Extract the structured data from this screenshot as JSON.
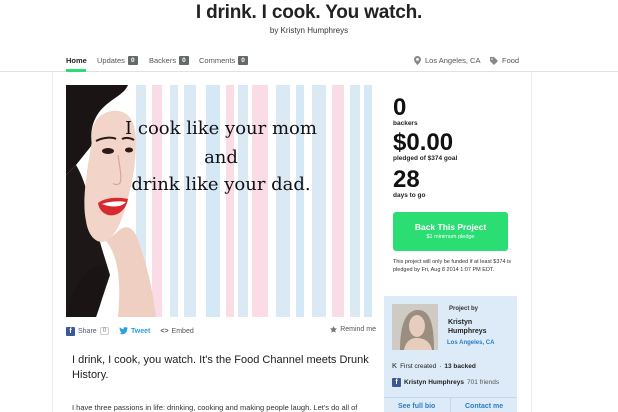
{
  "header": {
    "title": "I drink. I cook. You watch.",
    "byline": "by Kristyn Humphreys"
  },
  "nav": {
    "tabs": [
      {
        "label": "Home",
        "count": null
      },
      {
        "label": "Updates",
        "count": "0"
      },
      {
        "label": "Backers",
        "count": "0"
      },
      {
        "label": "Comments",
        "count": "0"
      }
    ],
    "location": "Los Angeles, CA",
    "category": "Food"
  },
  "video": {
    "line1": "I cook like your mom",
    "line2": "and",
    "line3": "drink like your dad."
  },
  "share": {
    "facebook": "Share",
    "facebook_count": "0",
    "tweet": "Tweet",
    "embed": "Embed",
    "remind": "Remind me"
  },
  "stats": {
    "backers_value": "0",
    "backers_label": "backers",
    "pledged_value": "$0.00",
    "pledged_label": "pledged of $374 goal",
    "days_value": "28",
    "days_label": "days to go"
  },
  "cta": {
    "label": "Back This Project",
    "sub": "$1 minimum pledge"
  },
  "funding_note": "This project will only be funded if at least $374 is pledged by Fri, Aug 8 2014 1:07 PM EDT.",
  "creator": {
    "heading": "Project by",
    "name_line1": "Kristyn",
    "name_line2": "Humphreys",
    "location": "Los Angeles, CA",
    "first_created": "First created",
    "backed": "13 backed",
    "fb_name": "Kristyn Humphreys",
    "fb_friends": "701 friends",
    "see_bio": "See full bio",
    "contact": "Contact me"
  },
  "blurb": {
    "lead": "I drink, I cook, you watch. It's the Food Channel meets Drunk History.",
    "body": "I have three passions in life: drinking, cooking and making people laugh. Let's do all of"
  },
  "colors": {
    "accent_green": "#2bde73",
    "link_blue": "#2e7bc4",
    "creator_bg": "#dcebf7"
  }
}
